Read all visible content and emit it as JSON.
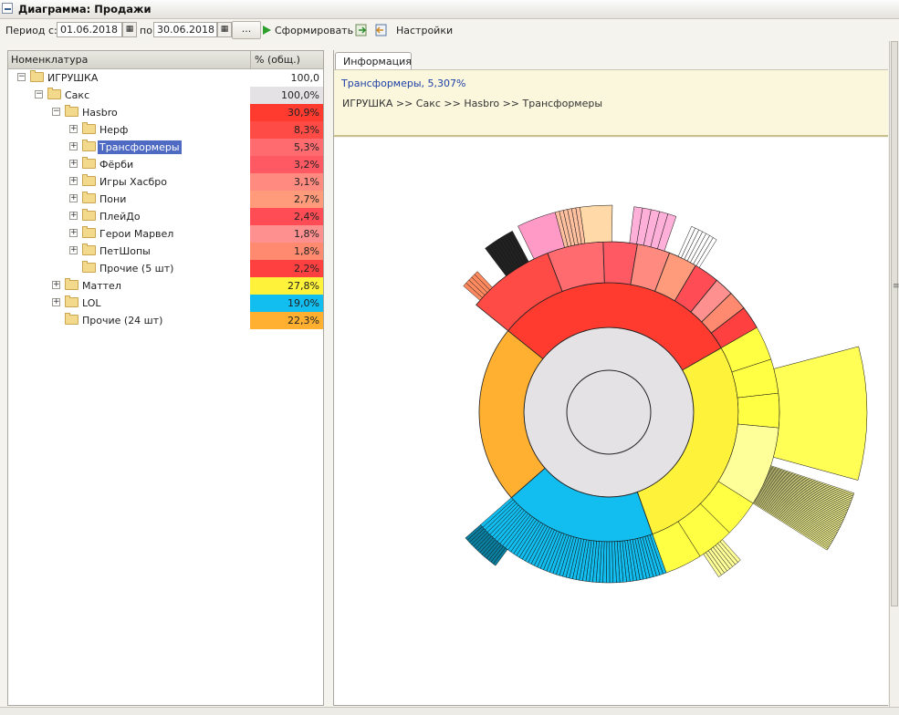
{
  "window": {
    "title": "Диаграмма: Продажи"
  },
  "toolbar": {
    "period_from_label": "Период с:",
    "period_from": "01.06.2018",
    "period_to_label": "по:",
    "period_to": "30.06.2018",
    "dots_label": "...",
    "run_label": "Сформировать",
    "settings_label": "Настройки"
  },
  "tree": {
    "col_name": "Номенклатура",
    "col_pct": "% (общ.)",
    "rows": [
      {
        "name": "ИГРУШКА",
        "pct": "100,0",
        "level": 0,
        "toggle": "−",
        "color": "#ffffff"
      },
      {
        "name": "Сакс",
        "pct": "100,0%",
        "level": 1,
        "toggle": "−",
        "color": "#e5e2e5"
      },
      {
        "name": "Hasbro",
        "pct": "30,9%",
        "level": 2,
        "toggle": "−",
        "color": "#ff3b30"
      },
      {
        "name": "Нерф",
        "pct": "8,3%",
        "level": 3,
        "toggle": "+",
        "color": "#ff4b45"
      },
      {
        "name": "Трансформеры",
        "pct": "5,3%",
        "level": 3,
        "toggle": "+",
        "color": "#ff6b6f",
        "selected": true
      },
      {
        "name": "Фёрби",
        "pct": "3,2%",
        "level": 3,
        "toggle": "+",
        "color": "#ff5a63"
      },
      {
        "name": "Игры Хасбро",
        "pct": "3,1%",
        "level": 3,
        "toggle": "+",
        "color": "#ff8a80"
      },
      {
        "name": "Пони",
        "pct": "2,7%",
        "level": 3,
        "toggle": "+",
        "color": "#ff9a7a"
      },
      {
        "name": "ПлейДо",
        "pct": "2,4%",
        "level": 3,
        "toggle": "+",
        "color": "#ff4c55"
      },
      {
        "name": "Герои Марвел",
        "pct": "1,8%",
        "level": 3,
        "toggle": "+",
        "color": "#ff9090"
      },
      {
        "name": "ПетШопы",
        "pct": "1,8%",
        "level": 3,
        "toggle": "+",
        "color": "#ff8a70"
      },
      {
        "name": "Прочие (5 шт)",
        "pct": "2,2%",
        "level": 3,
        "toggle": "",
        "color": "#ff4040"
      },
      {
        "name": "Маттел",
        "pct": "27,8%",
        "level": 2,
        "toggle": "+",
        "color": "#fff23a"
      },
      {
        "name": "LOL",
        "pct": "19,0%",
        "level": 2,
        "toggle": "+",
        "color": "#12bdf0"
      },
      {
        "name": "Прочие (24 шт)",
        "pct": "22,3%",
        "level": 2,
        "toggle": "",
        "color": "#ffb030"
      }
    ]
  },
  "tabs": {
    "info": "Информация"
  },
  "info": {
    "line1": "Трансформеры, 5,307%",
    "path": "ИГРУШКА >> Сакс >> Hasbro >> Трансформеры"
  },
  "chart_data": {
    "type": "sunburst",
    "rings": [
      {
        "level": "root",
        "segments": [
          {
            "name": "ИГРУШКА",
            "value": 100.0,
            "color": "#ffffff"
          }
        ]
      },
      {
        "level": 1,
        "segments": [
          {
            "name": "Сакс",
            "value": 100.0,
            "color": "#e5e2e5"
          }
        ]
      },
      {
        "level": 2,
        "segments": [
          {
            "name": "Hasbro",
            "value": 30.9,
            "color": "#ff3b30"
          },
          {
            "name": "Маттел",
            "value": 27.8,
            "color": "#fff23a"
          },
          {
            "name": "LOL",
            "value": 19.0,
            "color": "#12bdf0"
          },
          {
            "name": "Прочие (24 шт)",
            "value": 22.3,
            "color": "#ffb030"
          }
        ]
      },
      {
        "level": 3,
        "parent": "Hasbro",
        "segments": [
          {
            "name": "Нерф",
            "value": 8.3,
            "color": "#ff4b45"
          },
          {
            "name": "Трансформеры",
            "value": 5.3,
            "color": "#ff6b6f"
          },
          {
            "name": "Фёрби",
            "value": 3.2,
            "color": "#ff5a63"
          },
          {
            "name": "Игры Хасбро",
            "value": 3.1,
            "color": "#ff8a80"
          },
          {
            "name": "Пони",
            "value": 2.7,
            "color": "#ff9a7a"
          },
          {
            "name": "ПлейДо",
            "value": 2.4,
            "color": "#ff4c55"
          },
          {
            "name": "Герои Марвел",
            "value": 1.8,
            "color": "#ff9090"
          },
          {
            "name": "ПетШопы",
            "value": 1.8,
            "color": "#ff8a70"
          },
          {
            "name": "Прочие (5 шт)",
            "value": 2.2,
            "color": "#ff4040"
          }
        ]
      }
    ],
    "selected": "Трансформеры"
  }
}
